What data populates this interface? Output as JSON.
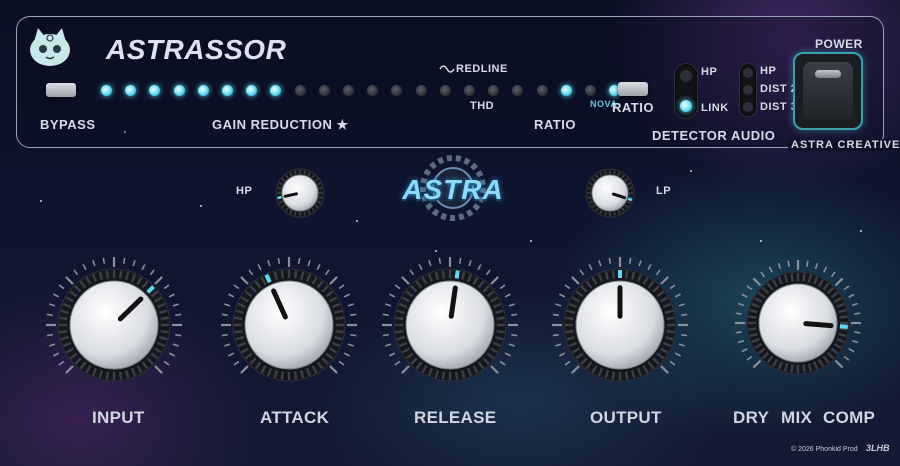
{
  "header": {
    "title": "ASTRASSOR",
    "brand": "ASTRA CREATIVE",
    "bypass_label": "BYPASS",
    "gain_reduction_label": "GAIN REDUCTION ★",
    "redline_label": "REDLINE",
    "thd_label": "THD",
    "ratio_label": "RATIO",
    "ratio_button_label": "RATIO",
    "nova_label": "NOVA",
    "power_label": "POWER"
  },
  "meter": {
    "led_states": [
      1,
      1,
      1,
      1,
      1,
      1,
      1,
      1,
      0,
      0,
      0,
      0,
      0,
      0,
      0,
      0,
      0,
      0,
      0,
      1,
      0,
      1,
      0
    ],
    "accent_color": "#5fd9f0"
  },
  "detector": {
    "label": "DETECTOR",
    "options": [
      "HP",
      "LINK"
    ],
    "selected": "LINK"
  },
  "audio": {
    "label": "AUDIO",
    "options": [
      "HP",
      "DIST 2",
      "DIST 3"
    ]
  },
  "filters": {
    "hp_label": "HP",
    "lp_label": "LP",
    "logo": "ASTRA"
  },
  "knobs": {
    "input": {
      "label": "INPUT",
      "value": 0.67
    },
    "attack": {
      "label": "ATTACK",
      "value": 0.41
    },
    "release": {
      "label": "RELEASE",
      "value": 0.53
    },
    "output": {
      "label": "OUTPUT",
      "value": 0.5
    },
    "mix": {
      "label": "MIX",
      "left_label": "DRY",
      "right_label": "COMP",
      "value": 0.85
    },
    "hp": {
      "value": 0.12
    },
    "lp": {
      "value": 0.9
    }
  },
  "footer": {
    "copyright": "© 2026 Phonkid Prod",
    "logo": "3LHB"
  }
}
